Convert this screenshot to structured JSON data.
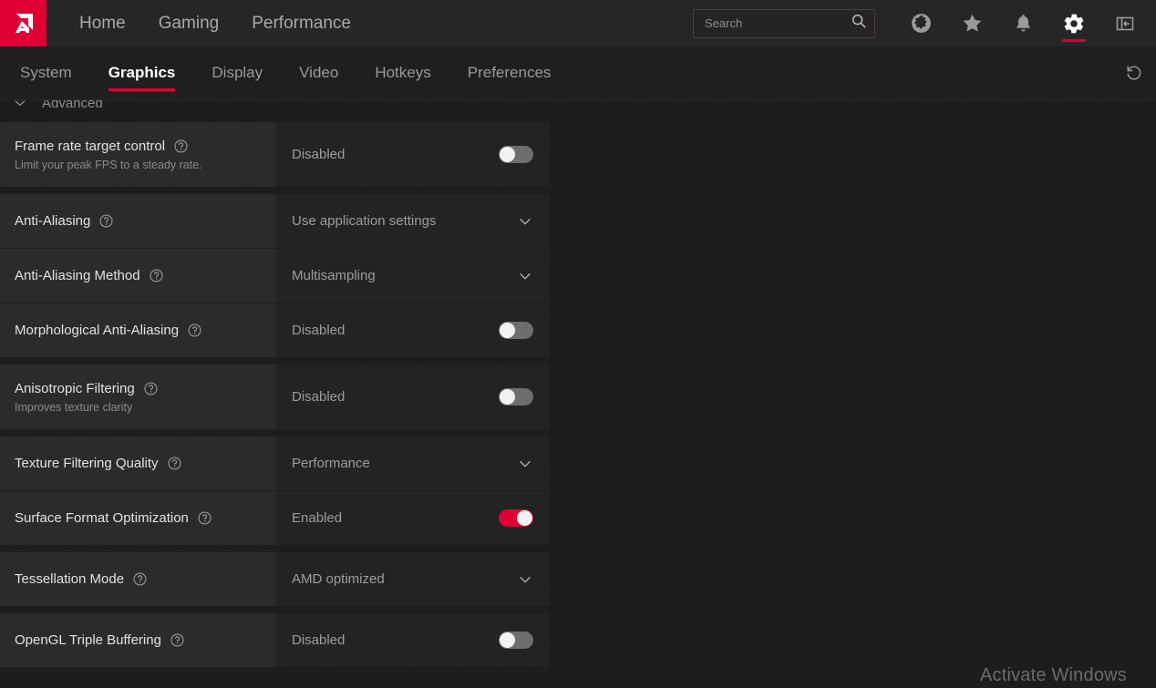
{
  "app": {
    "logo_icon": "amd-logo-icon",
    "accent_color": "#e00034",
    "background_color": "#1c1c1c"
  },
  "topnav": {
    "items": [
      {
        "label": "Home",
        "active": false
      },
      {
        "label": "Gaming",
        "active": false
      },
      {
        "label": "Performance",
        "active": false
      }
    ],
    "search": {
      "placeholder": "Search",
      "value": "",
      "icon": "search-icon"
    },
    "icons": [
      {
        "name": "globe-icon",
        "label": "Globe",
        "active": false
      },
      {
        "name": "star-icon",
        "label": "Star",
        "active": false
      },
      {
        "name": "bell-icon",
        "label": "Notifications",
        "active": false
      },
      {
        "name": "gear-icon",
        "label": "Settings",
        "active": true
      },
      {
        "name": "panel-collapse-icon",
        "label": "Collapse panel",
        "active": false
      }
    ]
  },
  "tabs": [
    {
      "label": "System",
      "active": false
    },
    {
      "label": "Graphics",
      "active": true
    },
    {
      "label": "Display",
      "active": false
    },
    {
      "label": "Video",
      "active": false
    },
    {
      "label": "Hotkeys",
      "active": false
    },
    {
      "label": "Preferences",
      "active": false
    }
  ],
  "reset": {
    "icon": "reset-icon",
    "label": "Reset"
  },
  "section": {
    "title": "Advanced",
    "chevron": "chevron-down-icon",
    "expanded": true
  },
  "settings": [
    {
      "label": "Frame rate target control",
      "description": "Limit your peak FPS to a steady rate.",
      "value": "Disabled",
      "control": "toggle",
      "state": "off"
    },
    {
      "label": "Anti-Aliasing",
      "description": "",
      "value": "Use application settings",
      "control": "dropdown",
      "state": ""
    },
    {
      "label": "Anti-Aliasing Method",
      "description": "",
      "value": "Multisampling",
      "control": "dropdown",
      "state": ""
    },
    {
      "label": "Morphological Anti-Aliasing",
      "description": "",
      "value": "Disabled",
      "control": "toggle",
      "state": "off"
    },
    {
      "label": "Anisotropic Filtering",
      "description": "Improves texture clarity",
      "value": "Disabled",
      "control": "toggle",
      "state": "off"
    },
    {
      "label": "Texture Filtering Quality",
      "description": "",
      "value": "Performance",
      "control": "dropdown",
      "state": ""
    },
    {
      "label": "Surface Format Optimization",
      "description": "",
      "value": "Enabled",
      "control": "toggle",
      "state": "on"
    },
    {
      "label": "Tessellation Mode",
      "description": "",
      "value": "AMD optimized",
      "control": "dropdown",
      "state": ""
    },
    {
      "label": "OpenGL Triple Buffering",
      "description": "",
      "value": "Disabled",
      "control": "toggle",
      "state": "off"
    }
  ],
  "groups": [
    [
      0
    ],
    [
      1,
      2,
      3
    ],
    [
      4
    ],
    [
      5,
      6
    ],
    [
      7
    ],
    [
      8
    ]
  ],
  "watermark": {
    "text": "Activate Windows"
  }
}
